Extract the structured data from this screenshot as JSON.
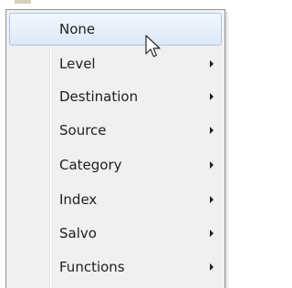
{
  "menu": {
    "items": [
      {
        "label": "None",
        "has_submenu": false,
        "highlighted": true
      },
      {
        "label": "Level",
        "has_submenu": true,
        "highlighted": false
      },
      {
        "label": "Destination",
        "has_submenu": true,
        "highlighted": false
      },
      {
        "label": "Source",
        "has_submenu": true,
        "highlighted": false
      },
      {
        "label": "Category",
        "has_submenu": true,
        "highlighted": false
      },
      {
        "label": "Index",
        "has_submenu": true,
        "highlighted": false
      },
      {
        "label": "Salvo",
        "has_submenu": true,
        "highlighted": false
      },
      {
        "label": "Functions",
        "has_submenu": true,
        "highlighted": false
      }
    ]
  },
  "icons": {
    "submenu_arrow": "chevron-right-icon",
    "pointer": "mouse-cursor-icon"
  },
  "colors": {
    "menu_background": "#f0f0f0",
    "highlight_border": "#a9c7ee",
    "highlight_fill": "#dde9f8",
    "text": "#1e1e1e"
  }
}
